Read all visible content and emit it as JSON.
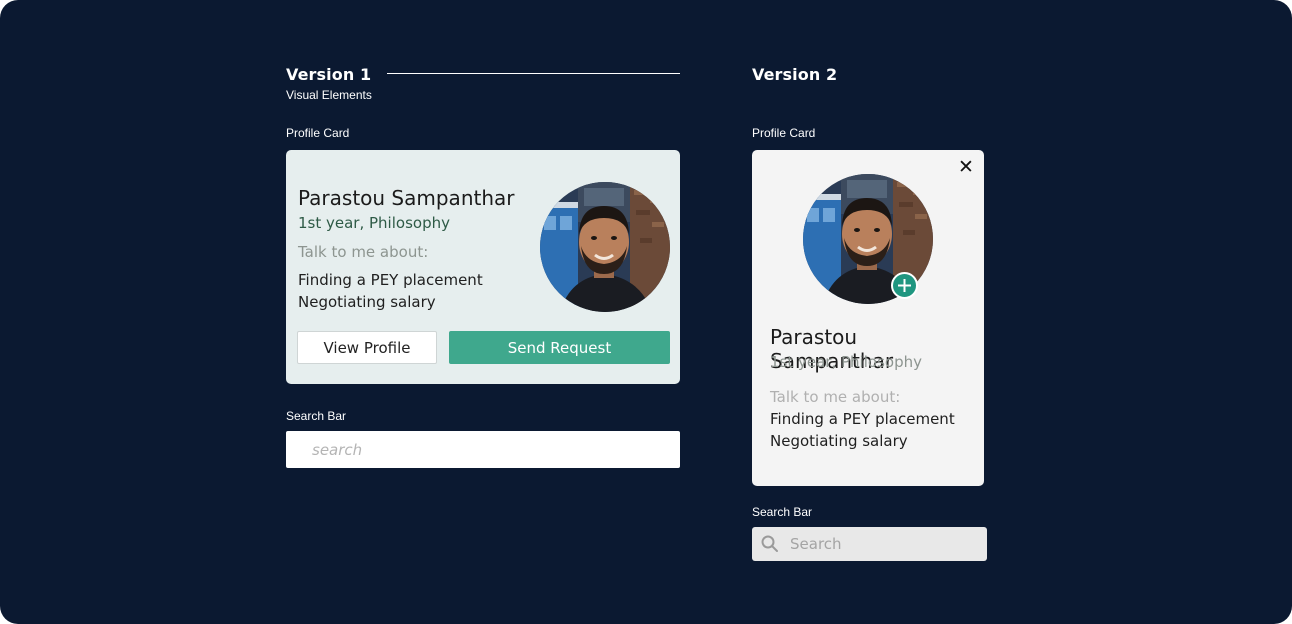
{
  "version1": {
    "title": "Version 1",
    "subtitle": "Visual Elements",
    "profile_label": "Profile Card",
    "card": {
      "name": "Parastou Sampanthar",
      "year": "1st year, Philosophy",
      "talk_label": "Talk to me about:",
      "topics": [
        "Finding a PEY placement",
        "Negotiating salary"
      ],
      "view_button": "View Profile",
      "send_button": "Send Request"
    },
    "search_label": "Search Bar",
    "search_placeholder": "search"
  },
  "version2": {
    "title": "Version 2",
    "profile_label": "Profile Card",
    "card": {
      "name": "Parastou Sampanthar",
      "year": "1st year, Philosophy",
      "talk_label": "Talk to me about:",
      "topics": [
        "Finding a PEY placement",
        "Negotiating salary"
      ],
      "close_icon": "close-icon",
      "add_icon": "plus-icon"
    },
    "search_label": "Search Bar",
    "search_placeholder": "Search"
  },
  "colors": {
    "background": "#0b1931",
    "accent_green": "#3fa88d",
    "badge_green": "#1f9680",
    "v1_card": "#e6eeee",
    "v2_card": "#f4f4f4",
    "v1_year_text": "#2e5a46",
    "muted_text": "#8d9590"
  }
}
